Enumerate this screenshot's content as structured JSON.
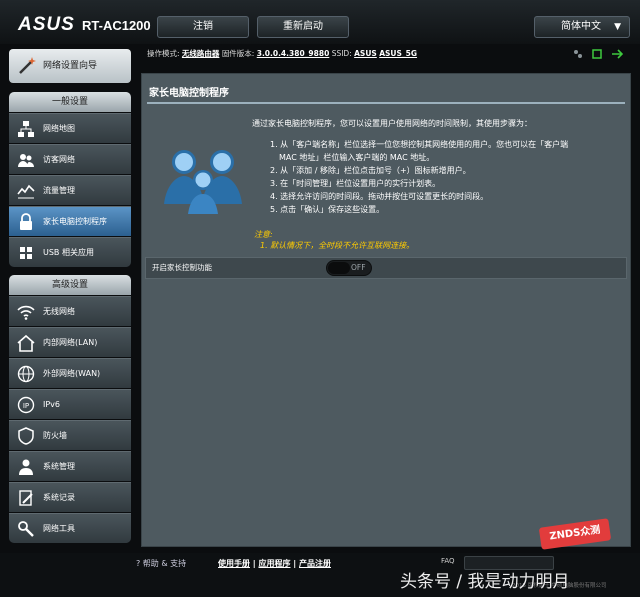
{
  "header": {
    "brand": "ASUS",
    "model": "RT-AC1200",
    "logout": "注销",
    "reboot": "重新启动",
    "language": "简体中文"
  },
  "status": {
    "mode_label": "操作模式:",
    "mode_value": "无线路由器",
    "fw_label": "固件版本:",
    "fw_value": "3.0.0.4.380_9880",
    "ssid_label": "SSID:",
    "ssid_1": "ASUS",
    "ssid_2": "ASUS_5G"
  },
  "sidebar": {
    "qis": "网络设置向导",
    "general_title": "一般设置",
    "general": [
      {
        "label": "网络地图",
        "icon": "network-map-icon"
      },
      {
        "label": "访客网络",
        "icon": "guest-network-icon"
      },
      {
        "label": "流量管理",
        "icon": "traffic-manager-icon"
      },
      {
        "label": "家长电脑控制程序",
        "icon": "parental-control-icon"
      },
      {
        "label": "USB 相关应用",
        "icon": "usb-application-icon"
      }
    ],
    "advanced_title": "高级设置",
    "advanced": [
      {
        "label": "无线网络",
        "icon": "wireless-icon"
      },
      {
        "label": "内部网络(LAN)",
        "icon": "lan-icon"
      },
      {
        "label": "外部网络(WAN)",
        "icon": "wan-icon"
      },
      {
        "label": "IPv6",
        "icon": "ipv6-icon"
      },
      {
        "label": "防火墙",
        "icon": "firewall-icon"
      },
      {
        "label": "系统管理",
        "icon": "administration-icon"
      },
      {
        "label": "系统记录",
        "icon": "system-log-icon"
      },
      {
        "label": "网络工具",
        "icon": "network-tools-icon"
      }
    ]
  },
  "main": {
    "title": "家长电脑控制程序",
    "intro": "通过家长电脑控制程序，您可以设置用户使用网络的时间限制，其使用步骤为：",
    "steps": [
      "1. 从「客户端名称」栏位选择一位您想控制其网络使用的用户。您也可以在「客户端",
      "MAC 地址」栏位输入客户端的 MAC 地址。",
      "2. 从「添加 / 移除」栏位点击加号（+）图标新增用户。",
      "3. 在「时间管理」栏位设置用户的实行计划表。",
      "4. 选择允许访问的时间段。拖动并按住可设置更长的时间段。",
      "5. 点击「确认」保存这些设置。"
    ],
    "note_title": "注意:",
    "note": "1. 默认情况下，全时段不允许互联网连接。",
    "enable_label": "开启家长控制功能",
    "toggle_state": "OFF",
    "toggle_on": false
  },
  "footer": {
    "help": "帮助 & 支持",
    "manual": "使用手册",
    "utility": "应用程序",
    "register": "产品注册",
    "faq": "FAQ",
    "copyright": "2015 版权属于 华硕电脑股份有限公司"
  },
  "overlay": {
    "stamp": "ZNDS众测",
    "watermark": "头条号 / 我是动力明月"
  },
  "colors": {
    "active": "#3d79ad",
    "panel": "#4e5a60",
    "note": "#ffcc00"
  }
}
